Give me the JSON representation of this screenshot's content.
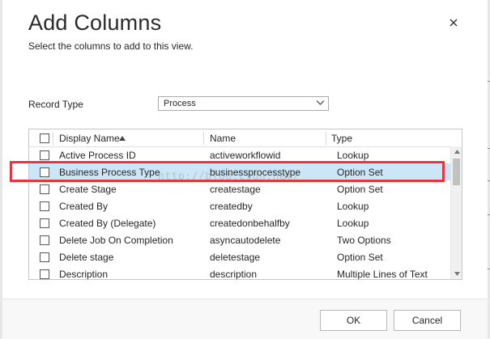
{
  "dialog": {
    "title": "Add Columns",
    "subtitle": "Select the columns to add to this view.",
    "close_icon": "close-icon"
  },
  "record_type": {
    "label": "Record Type",
    "selected": "Process",
    "icon": "chevron-down-icon"
  },
  "grid": {
    "columns": [
      "Display Name",
      "Name",
      "Type"
    ],
    "sort_icon": "sort-ascending-icon",
    "rows": [
      {
        "display": "Active Process ID",
        "name": "activeworkflowid",
        "type": "Lookup",
        "selected": false
      },
      {
        "display": "Business Process Type",
        "name": "businessprocesstype",
        "type": "Option Set",
        "selected": true
      },
      {
        "display": "Create Stage",
        "name": "createstage",
        "type": "Option Set",
        "selected": false
      },
      {
        "display": "Created By",
        "name": "createdby",
        "type": "Lookup",
        "selected": false
      },
      {
        "display": "Created By (Delegate)",
        "name": "createdonbehalfby",
        "type": "Lookup",
        "selected": false
      },
      {
        "display": "Delete Job On Completion",
        "name": "asyncautodelete",
        "type": "Two Options",
        "selected": false
      },
      {
        "display": "Delete stage",
        "name": "deletestage",
        "type": "Option Set",
        "selected": false
      },
      {
        "display": "Description",
        "name": "description",
        "type": "Multiple Lines of Text",
        "selected": false
      }
    ]
  },
  "watermark": "http://blog.csdn.net/",
  "footer": {
    "ok_label": "OK",
    "cancel_label": "Cancel"
  },
  "colors": {
    "highlight": "#e8343c",
    "selected_row": "#cde6f7"
  }
}
